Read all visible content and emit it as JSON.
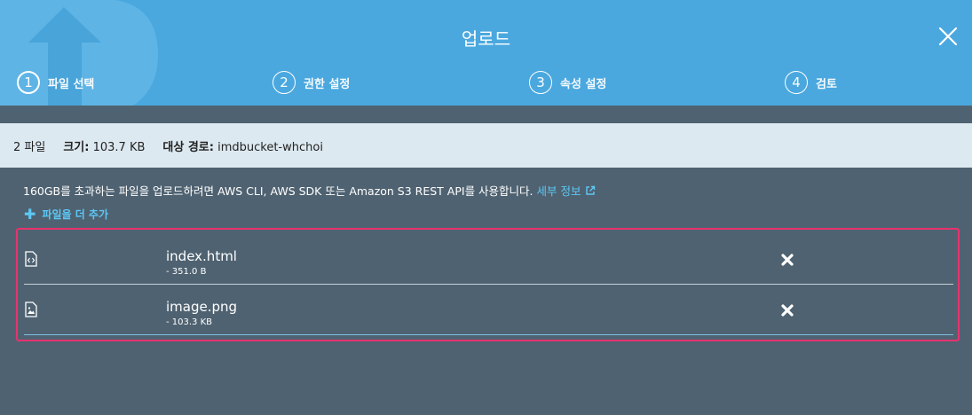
{
  "header": {
    "title": "업로드",
    "steps": [
      {
        "number": "1",
        "label": "파일 선택",
        "active": true
      },
      {
        "number": "2",
        "label": "권한 설정",
        "active": false
      },
      {
        "number": "3",
        "label": "속성 설정",
        "active": false
      },
      {
        "number": "4",
        "label": "검토",
        "active": false
      }
    ]
  },
  "info": {
    "file_count": "2 파일",
    "size_label": "크기:",
    "size_value": "103.7 KB",
    "target_label": "대상 경로:",
    "target_value": "imdbucket-whchoi"
  },
  "notice": {
    "text": "160GB를 초과하는 파일을 업로드하려면 AWS CLI, AWS SDK 또는 Amazon S3 REST API를 사용합니다.",
    "link_text": "세부 정보"
  },
  "add_more_label": "파일을 더 추가",
  "files": [
    {
      "name": "index.html",
      "size": "- 351.0 B",
      "icon": "html-file-icon"
    },
    {
      "name": "image.png",
      "size": "- 103.3 KB",
      "icon": "image-file-icon"
    }
  ],
  "colors": {
    "header_bg": "#4aa8df",
    "body_bg": "#4f6271",
    "infobar_bg": "#dde9f0",
    "link": "#5cc8f5",
    "highlight_border": "#e8326e"
  }
}
